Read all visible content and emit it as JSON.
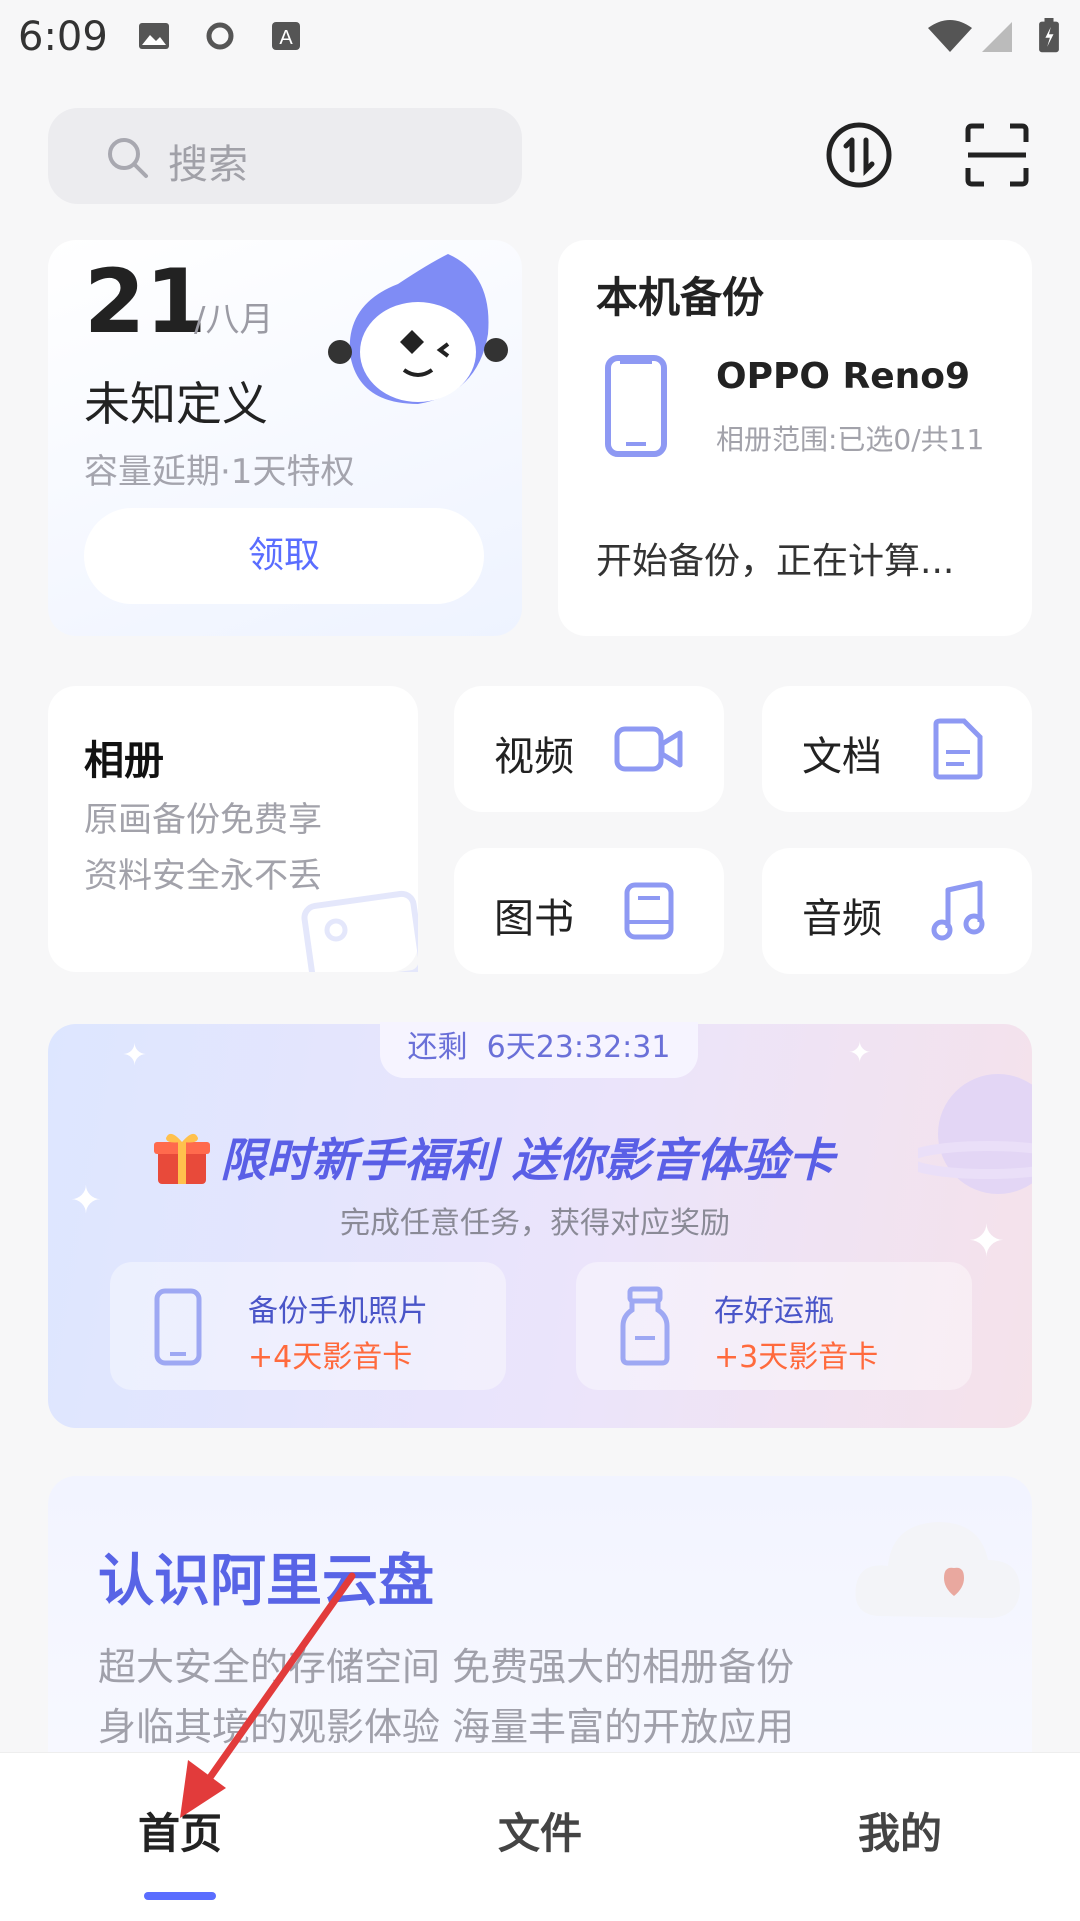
{
  "status_bar": {
    "time": "6:09"
  },
  "search": {
    "placeholder": "搜索"
  },
  "privilege_card": {
    "day": "21",
    "month": "/八月",
    "title": "未知定义",
    "desc": "容量延期·1天特权",
    "button": "领取"
  },
  "backup_card": {
    "title": "本机备份",
    "device_name": "OPPO Reno9",
    "scope": "相册范围:已选0/共11",
    "status": "开始备份，正在计算..."
  },
  "album_card": {
    "title": "相册",
    "line1": "原画备份免费享",
    "line2": "资料安全永不丢"
  },
  "quick_items": [
    {
      "label": "视频",
      "icon": "video-camera-icon"
    },
    {
      "label": "文档",
      "icon": "document-icon"
    },
    {
      "label": "图书",
      "icon": "book-icon"
    },
    {
      "label": "音频",
      "icon": "music-note-icon"
    }
  ],
  "promo": {
    "timer_prefix": "还剩",
    "timer": "6天23:32:31",
    "title": "限时新手福利 送你影音体验卡",
    "subtitle": "完成任意任务，获得对应奖励",
    "tasks": [
      {
        "title": "备份手机照片",
        "reward": "+4天影音卡",
        "icon": "phone-icon"
      },
      {
        "title": "存好运瓶",
        "reward": "+3天影音卡",
        "icon": "bottle-icon"
      }
    ]
  },
  "intro": {
    "title": "认识阿里云盘",
    "line1": "超大安全的存储空间 免费强大的相册备份",
    "line2": "身临其境的观影体验 海量丰富的开放应用"
  },
  "tabs": [
    {
      "label": "首页",
      "active": true
    },
    {
      "label": "文件",
      "active": false
    },
    {
      "label": "我的",
      "active": false
    }
  ],
  "colors": {
    "accent": "#5a6dff",
    "reward": "#ff6a3d",
    "annotation_arrow": "#e23b3b"
  }
}
